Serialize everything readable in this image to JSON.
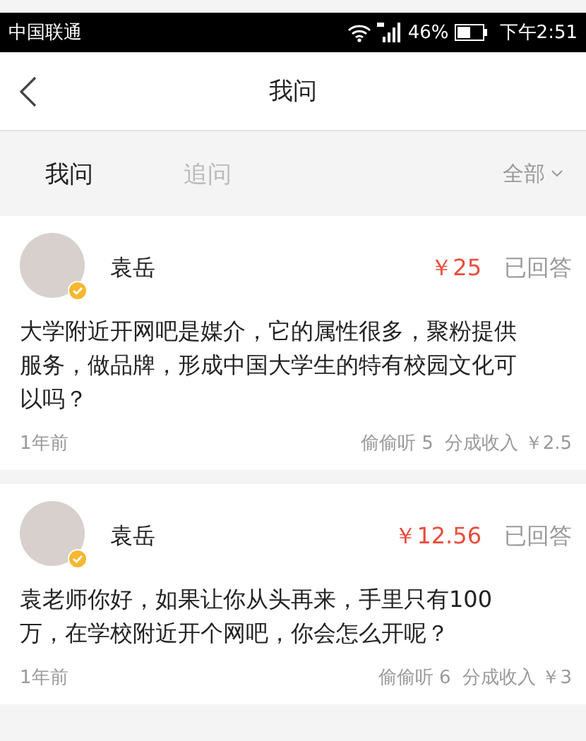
{
  "status_bar": {
    "carrier": "中国联通",
    "battery": "46%",
    "time": "下午2:51"
  },
  "nav": {
    "title": "我问"
  },
  "tabs": [
    {
      "label": "我问",
      "selected": true
    },
    {
      "label": "追问",
      "selected": false
    }
  ],
  "filter": {
    "label": "全部"
  },
  "questions": [
    {
      "name": "袁岳",
      "verified": true,
      "price": "￥25",
      "status": "已回答",
      "text": "大学附近开网吧是媒介，它的属性很多，聚粉提供服务，做品牌，形成中国大学生的特有校园文化可以吗？",
      "time": "1年前",
      "stats": "偷偷听 5  分成收入 ￥2.5"
    },
    {
      "name": "袁岳",
      "verified": true,
      "price": "￥12.56",
      "status": "已回答",
      "text": "袁老师你好，如果让你从头再来，手里只有100万，在学校附近开个网吧，你会怎么开呢？",
      "time": "1年前",
      "stats": "偷偷听 6  分成收入 ￥3"
    }
  ]
}
